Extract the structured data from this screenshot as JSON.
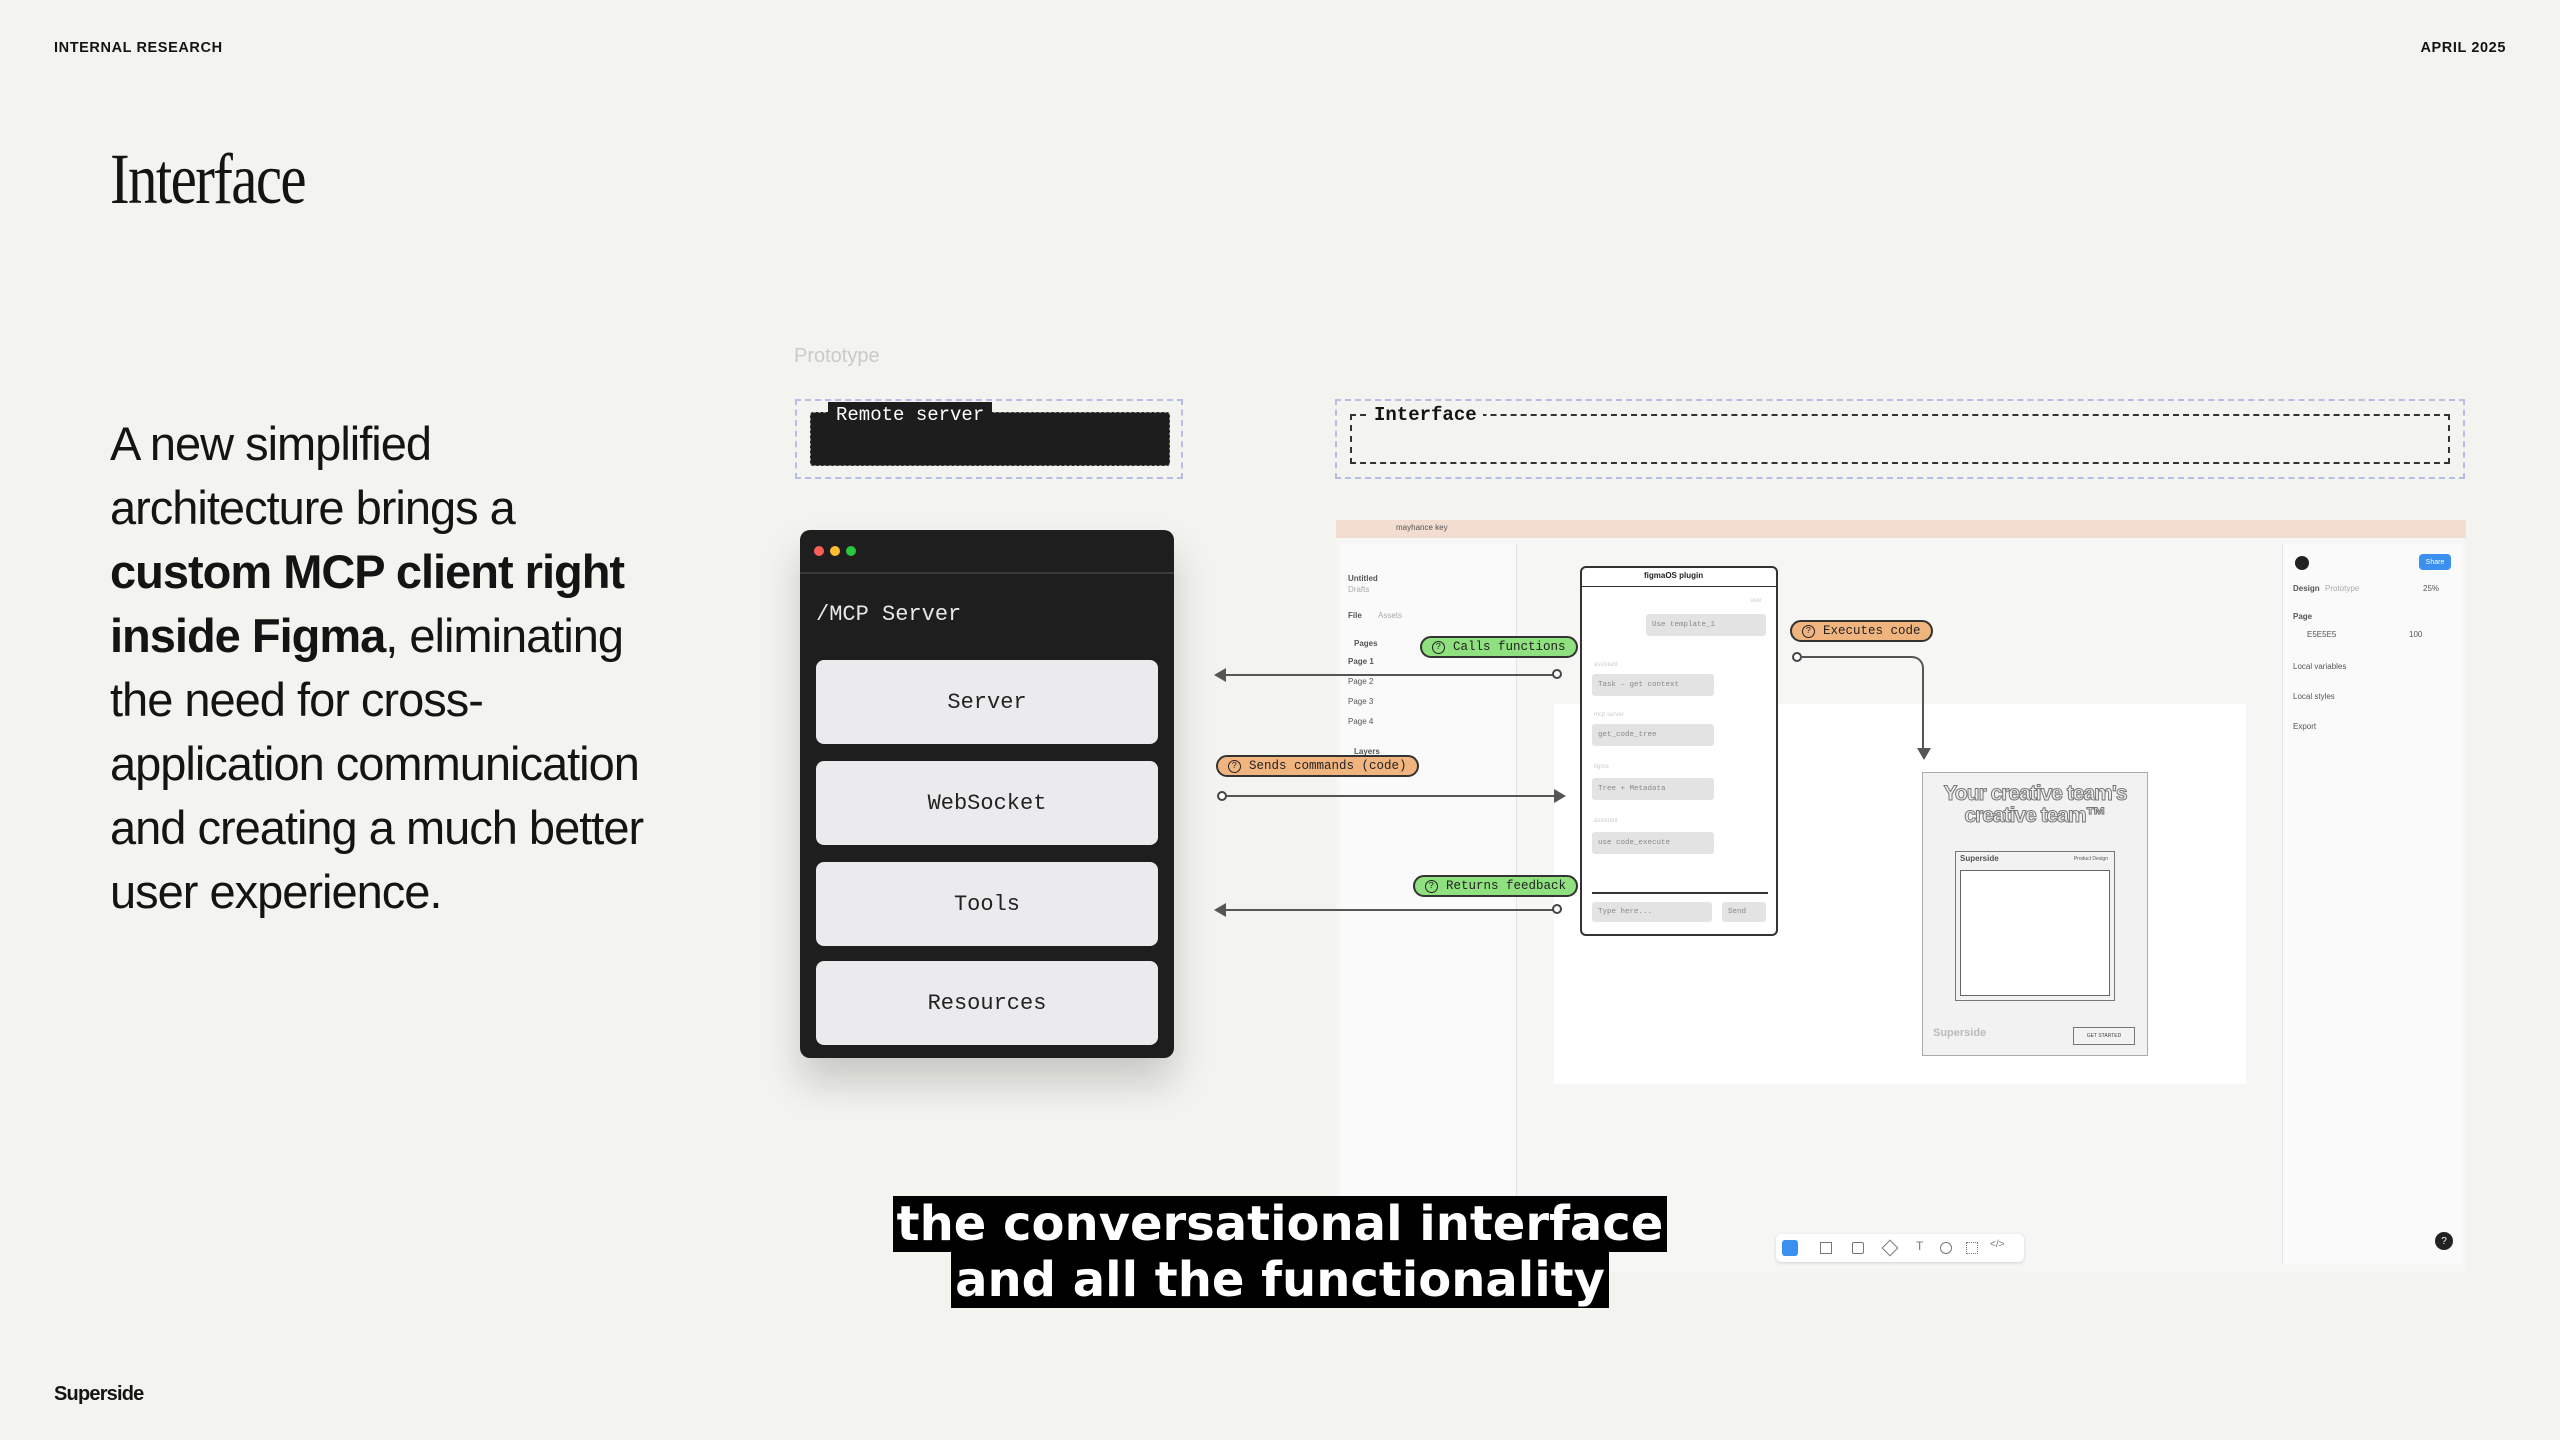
{
  "header": {
    "left": "INTERNAL RESEARCH",
    "right": "APRIL 2025"
  },
  "title": "Interface",
  "body": {
    "part1": "A new simplified architecture brings a ",
    "bold": "custom MCP client right inside Figma",
    "part2": ", eliminating the need for cross-application communication and creating a much better user experience."
  },
  "diagram": {
    "section_label": "Prototype",
    "remote_server_label": "Remote server",
    "interface_label": "Interface",
    "mcp": {
      "title": "/MCP Server",
      "buttons": [
        "Server",
        "WebSocket",
        "Tools",
        "Resources"
      ]
    },
    "pills": {
      "calls": "Calls functions",
      "sends": "Sends commands (code)",
      "returns": "Returns feedback",
      "executes": "Executes code"
    },
    "figma": {
      "tab_name": "mayhance key",
      "file_name": "Untitled",
      "drafts": "Drafts",
      "file_tab": "File",
      "assets_tab": "Assets",
      "pages_label": "Pages",
      "pages": [
        "Page 1",
        "Page 2",
        "Page 3",
        "Page 4"
      ],
      "layers_label": "Layers",
      "plugin_title": "figmaOS plugin",
      "plugin_rows": [
        {
          "label": "user",
          "text": "Use template_1"
        },
        {
          "label": "assistant",
          "text": "Task – get context"
        },
        {
          "label": "mcp server",
          "text": "get_code_tree"
        },
        {
          "label": "figma",
          "text": "Tree + Metadata"
        },
        {
          "label": "assistant",
          "text": "use code_execute"
        }
      ],
      "plugin_input": "Type here...",
      "plugin_send": "Send",
      "card_headline": "Your creative team's creative team™",
      "card_brand": "Superside",
      "card_sub": "Product Design",
      "card_footer_brand": "Superside",
      "card_footer_btn": "GET STARTED",
      "right_tabs": [
        "Design",
        "Prototype"
      ],
      "zoom": "25%",
      "share": "Share",
      "page_section": "Page",
      "page_color": "E5E5E5",
      "page_opacity": "100",
      "local_variables": "Local variables",
      "local_styles": "Local styles",
      "export": "Export",
      "help": "?"
    }
  },
  "subtitle": {
    "line1": "the conversational interface",
    "line2": "and all the functionality"
  },
  "logo": "Superside",
  "colors": {
    "green": "#8fe07e",
    "orange": "#f0b57f",
    "share_blue": "#3b8ff0",
    "bg": "#f3f4ef"
  }
}
